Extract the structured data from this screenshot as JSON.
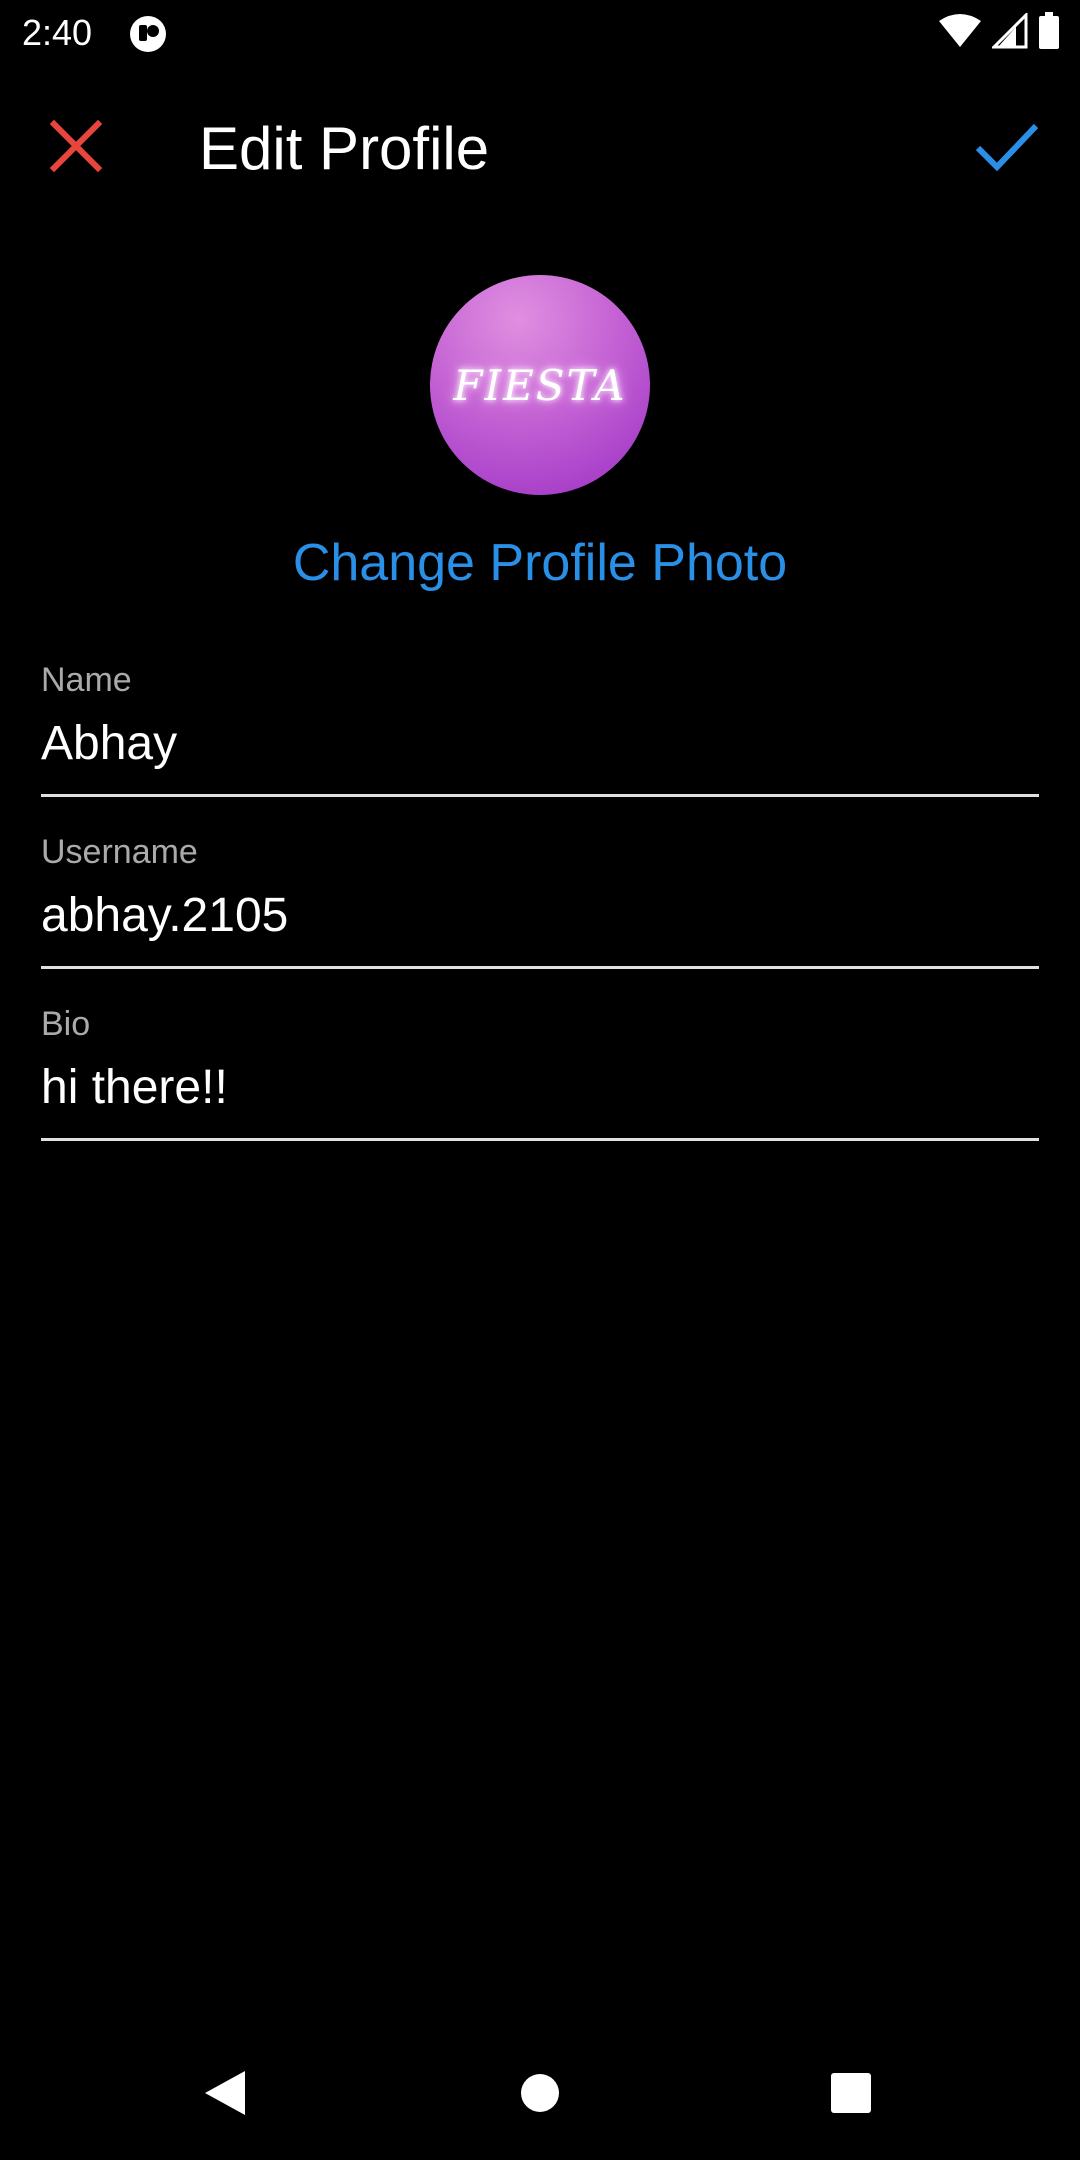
{
  "status_bar": {
    "time": "2:40",
    "icons": [
      "app-notification-icon",
      "wifi-icon",
      "cellular-signal-icon",
      "battery-icon"
    ]
  },
  "app_bar": {
    "title": "Edit Profile",
    "close_icon": "close-icon",
    "save_icon": "checkmark-icon",
    "close_color": "#e8453c",
    "save_color": "#2a8fe6"
  },
  "profile": {
    "avatar_text": "FIESTA",
    "change_photo_label": "Change Profile Photo",
    "accent_color": "#2a8fe6"
  },
  "form": {
    "name": {
      "label": "Name",
      "value": "Abhay"
    },
    "username": {
      "label": "Username",
      "value": "abhay.2105"
    },
    "bio": {
      "label": "Bio",
      "value": "hi there!!"
    }
  },
  "nav_bar": {
    "icons": [
      "back-icon",
      "home-icon",
      "recents-icon"
    ]
  }
}
